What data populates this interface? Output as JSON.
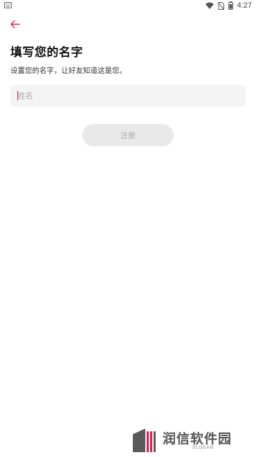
{
  "status_bar": {
    "time": "4:27",
    "left_icon": "keyboard-icon",
    "icons": [
      "wifi-icon",
      "no-sim-icon",
      "battery-icon"
    ]
  },
  "nav": {
    "back_icon": "back-arrow-icon",
    "accent_color": "#e8194b"
  },
  "page": {
    "title": "填写您的名字",
    "subtitle": "设置您的名字，让好友知道这是您。"
  },
  "form": {
    "name_placeholder": "姓名",
    "name_value": "",
    "register_label": "注册",
    "register_enabled": false
  },
  "watermark": {
    "text": "润信软件园",
    "slogan": "SLOGAN"
  }
}
